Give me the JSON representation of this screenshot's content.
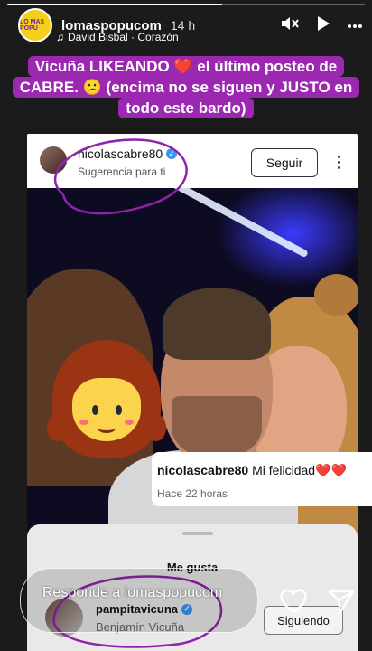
{
  "story": {
    "account": "lomaspopucom",
    "time_ago": "14 h",
    "avatar_text": "LO MAS POPU",
    "music": "David Bisbal · Corazón",
    "caption": "Vicuña LIKEANDO ❤️ el último posteo de CABRE. 😕 (encima no se siguen y JUSTO en todo este bardo)"
  },
  "post": {
    "username": "nicolascabre80",
    "subtitle": "Sugerencia para ti",
    "follow_label": "Seguir",
    "comment_user": "nicolascabre80",
    "comment_text": "Mi felicidad❤️❤️",
    "comment_time": "Hace 22 horas"
  },
  "likes_sheet": {
    "title": "Me gusta",
    "liker_username": "pampitavicuna",
    "liker_name": "Benjamín Vicuña",
    "following_label": "Siguiendo"
  },
  "reply": {
    "placeholder": "Responde a lomaspopucom"
  },
  "colors": {
    "caption_bg": "#9c27b0",
    "doodle": "#8e24aa",
    "verified": "#3897f0"
  }
}
